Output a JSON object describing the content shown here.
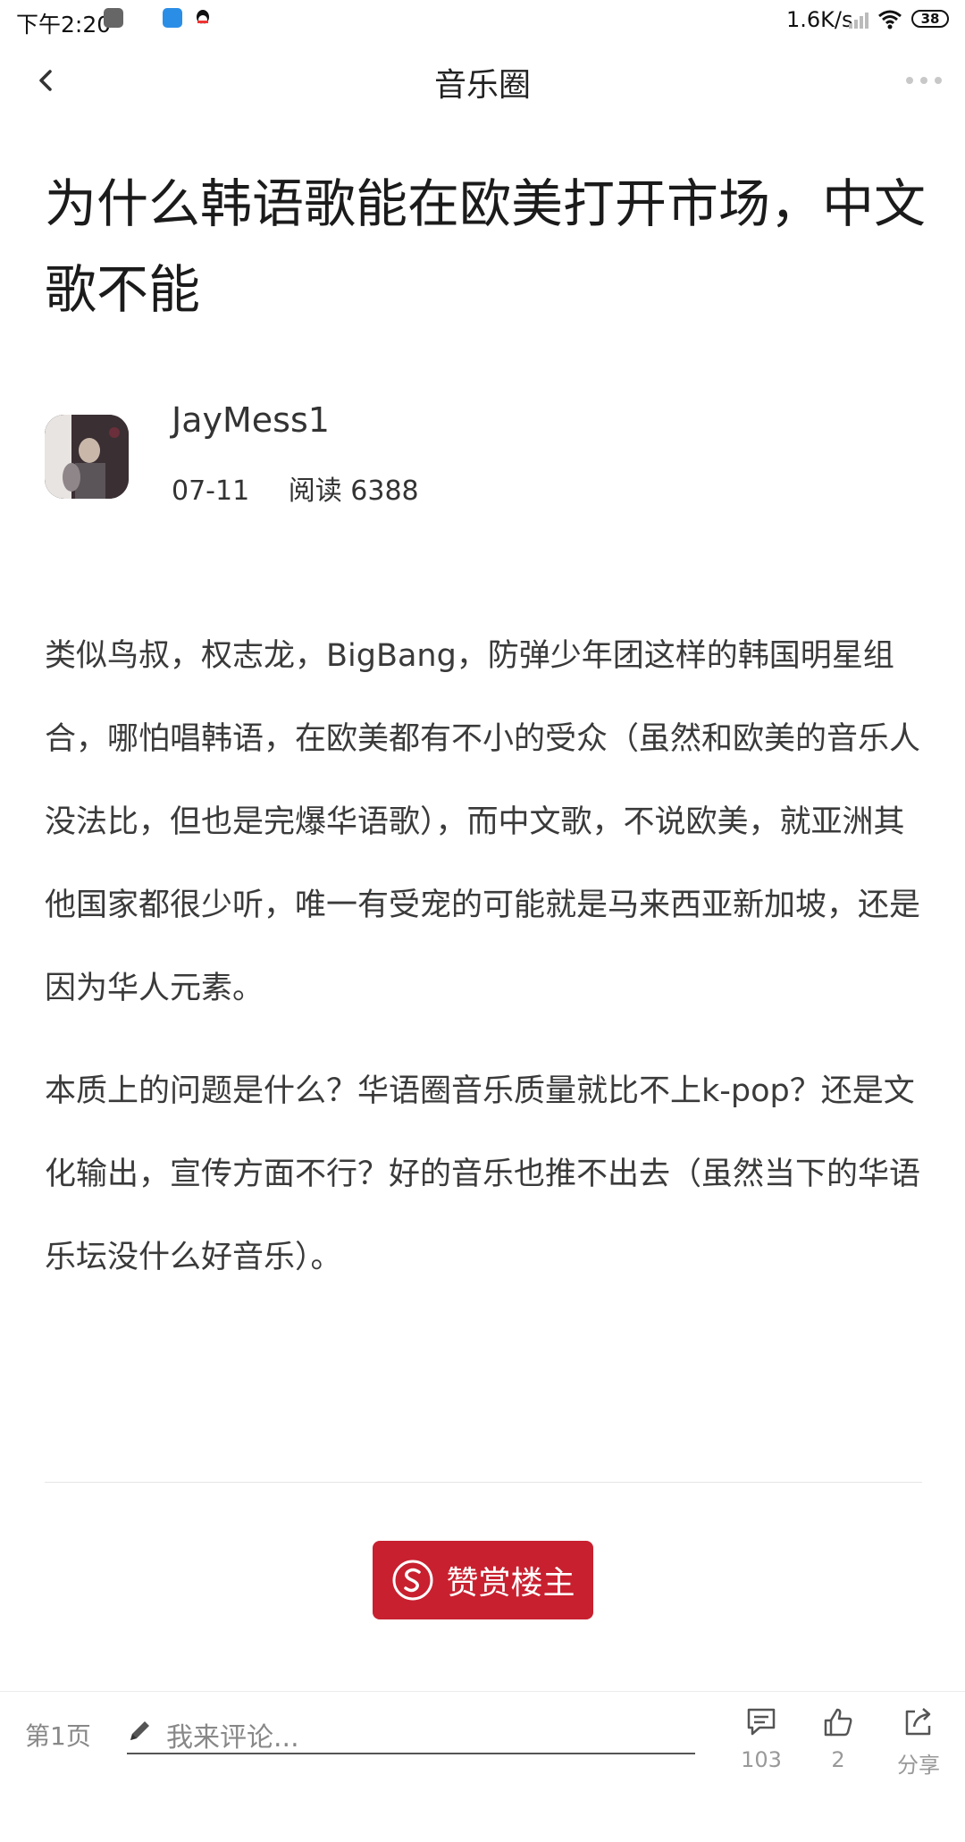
{
  "status_bar": {
    "time": "下午2:20",
    "speed": "1.6K/s",
    "battery": "38"
  },
  "nav": {
    "title": "音乐圈",
    "back_icon": "chevron-left-icon",
    "more_icon": "more-dots-icon"
  },
  "post": {
    "title": "为什么韩语歌能在欧美打开市场，中文歌不能",
    "author": "JayMess1",
    "date": "07-11",
    "read_label": "阅读",
    "read_count": "6388",
    "paragraphs": [
      "类似鸟叔，权志龙，BigBang，防弹少年团这样的韩国明星组合，哪怕唱韩语，在欧美都有不小的受众（虽然和欧美的音乐人没法比，但也是完爆华语歌），而中文歌，不说欧美，就亚洲其他国家都很少听，唯一有受宠的可能就是马来西亚新加坡，还是因为华人元素。",
      "本质上的问题是什么？华语圈音乐质量就比不上k-pop？还是文化输出，宣传方面不行？好的音乐也推不出去（虽然当下的华语乐坛没什么好音乐）。"
    ]
  },
  "reward": {
    "label": "赞赏楼主",
    "color": "#c8202f"
  },
  "bottom_bar": {
    "page": "第1页",
    "comment_placeholder": "我来评论...",
    "comments_count": "103",
    "likes_count": "2",
    "share_label": "分享"
  }
}
